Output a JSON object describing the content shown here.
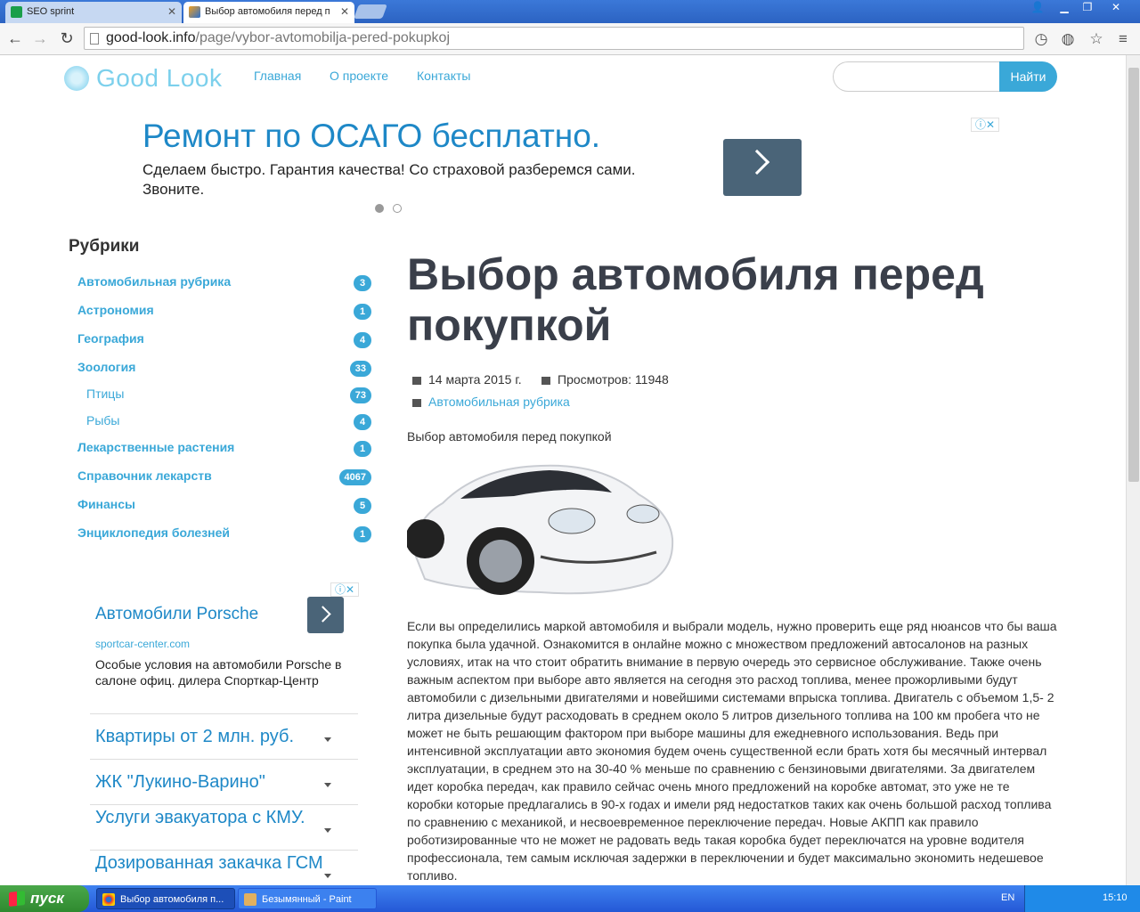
{
  "browser": {
    "tabs": [
      {
        "label": "SEO sprint"
      },
      {
        "label": "Выбор автомобиля перед п"
      }
    ],
    "url_host": "good-look.info",
    "url_path": "/page/vybor-avtomobilja-pered-pokupkoj"
  },
  "site": {
    "logo": "Good Look",
    "nav": [
      "Главная",
      "О проекте",
      "Контакты"
    ],
    "search_button": "Найти"
  },
  "ad_top": {
    "title": "Ремонт по ОСАГО бесплатно.",
    "text": "Сделаем быстро. Гарантия качества! Со страховой разберемся сами. Звоните."
  },
  "sidebar": {
    "title": "Рубрики",
    "categories": [
      {
        "label": "Автомобильная рубрика",
        "count": "3",
        "sub": false
      },
      {
        "label": "Астрономия",
        "count": "1",
        "sub": false
      },
      {
        "label": "География",
        "count": "4",
        "sub": false
      },
      {
        "label": "Зоология",
        "count": "33",
        "sub": false
      },
      {
        "label": "Птицы",
        "count": "73",
        "sub": true
      },
      {
        "label": "Рыбы",
        "count": "4",
        "sub": true
      },
      {
        "label": "Лекарственные растения",
        "count": "1",
        "sub": false
      },
      {
        "label": "Справочник лекарств",
        "count": "4067",
        "sub": false
      },
      {
        "label": "Финансы",
        "count": "5",
        "sub": false
      },
      {
        "label": "Энциклопедия болезней",
        "count": "1",
        "sub": false
      }
    ]
  },
  "ad_side": {
    "title": "Автомобили Porsche",
    "domain": "sportcar-center.com",
    "text": "Особые условия на автомобили Porsche в салоне офиц. дилера Спорткар-Центр",
    "links": [
      "Квартиры от 2 млн. руб.",
      "ЖК \"Лукино-Варино\"",
      "Услуги эвакуатора с КМУ.",
      "Дозированная закачка ГСМ"
    ]
  },
  "article": {
    "title": "Выбор автомобиля перед покупкой",
    "date": "14 марта 2015 г.",
    "views": "Просмотров: 11948",
    "category": "Автомобильная рубрика",
    "caption": "Выбор автомобиля перед покупкой",
    "body": "Если вы определились маркой автомобиля и выбрали модель, нужно проверить еще ряд нюансов что бы ваша покупка была удачной. Ознакомится в онлайне можно с множеством предложений автосалонов на разных условиях, итак на что стоит обратить внимание в первую очередь это сервисное обслуживание. Также очень важным аспектом при выборе авто является на сегодня это расход топлива, менее прожорливыми будут автомобили с дизельными двигателями и новейшими системами впрыска топлива. Двигатель с объемом 1,5- 2 литра дизельные будут расходовать в среднем около 5 литров дизельного топлива на 100 км пробега что не может не быть решающим фактором при выборе машины для ежедневного использования. Ведь при интенсивной эксплуатации авто экономия будем очень существенной если брать хотя бы месячный интервал эксплуатации, в среднем это на 30-40 % меньше по сравнению с бензиновыми двигателями. За двигателем идет коробка передач, как правило сейчас очень много предложений на коробке автомат, это уже не те коробки которые предлагались в 90-х годах и имели ряд недостатков таких как очень большой расход топлива по сравнению с механикой, и несвоевременное переключение передач. Новые АКПП как правило роботизированные что не может не радовать ведь такая коробка будет переключатся на уровне водителя профессионала, тем самым исключая задержки в переключении и будет максимально экономить недешевое топливо."
  },
  "taskbar": {
    "start": "пуск",
    "tasks": [
      "Выбор автомобиля п...",
      "Безымянный - Paint"
    ],
    "lang": "EN",
    "clock": "15:10"
  }
}
